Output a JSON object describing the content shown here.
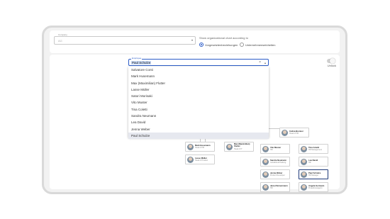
{
  "filters": {
    "company_label": "Company",
    "company_value": "AG",
    "show_label": "Show organizational chart according to",
    "radio_superior": "Vorgesetztenbeziehungen",
    "radio_units": "Unternehmenseinheiten"
  },
  "unlock": "Unlock",
  "employee": {
    "label": "Employee",
    "value": "Paul Schulze"
  },
  "dropdown": [
    "Salvatore Conti",
    "Mark Husemann",
    "Max (Maximilian) Flutter",
    "Lasse Müller",
    "Satori Morisaki",
    "Vito Muster",
    "Tina Coletti",
    "Sandra Neumann",
    "Lea David",
    "Jenna Weber",
    "Paul Schulze"
  ],
  "cards": [
    {
      "name": "Mark Husemann",
      "role": "Head of HR"
    },
    {
      "name": "Max (Maximilian) Flutter",
      "role": "Head of IT"
    },
    {
      "name": "Lasse Müller",
      "role": "Head of Product"
    },
    {
      "name": "Celina Brenner",
      "role": "Head of HR"
    },
    {
      "name": "Vito Muster",
      "role": "HR"
    },
    {
      "name": "Tina Coletti",
      "role": "HR Management"
    },
    {
      "name": "Sandra Neumann",
      "role": "Gehaltsbuchhaltung"
    },
    {
      "name": "Lea David",
      "role": "HR"
    },
    {
      "name": "Jenna Weber",
      "role": "Product Developer"
    },
    {
      "name": "Paul Schulze",
      "role": "HR Manager"
    },
    {
      "name": "Jana Zimmermann",
      "role": "HR"
    },
    {
      "name": "Angela Germann",
      "role": "Projektmanagerin"
    }
  ]
}
